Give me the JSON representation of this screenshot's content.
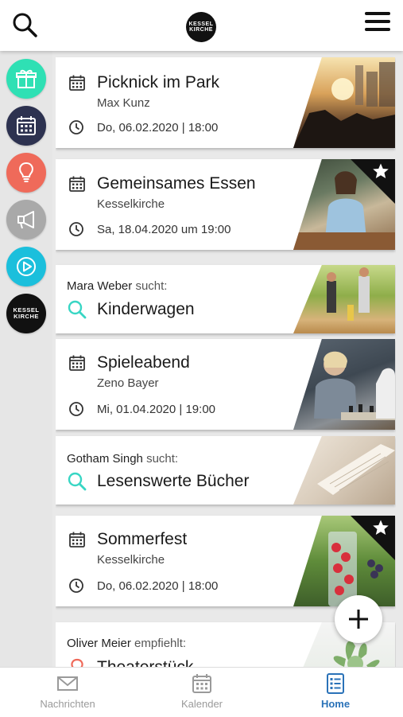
{
  "header": {
    "search_icon": "search-icon",
    "logo_line1": "KESSEL",
    "logo_line2": "KIRCHE",
    "menu_icon": "hamburger-menu-icon"
  },
  "rail": {
    "items": [
      {
        "icon": "gift-icon",
        "color": "#2fe0b4"
      },
      {
        "icon": "calendar-icon",
        "color": "#2d3250"
      },
      {
        "icon": "lightbulb-icon",
        "color": "#ef6a5a"
      },
      {
        "icon": "megaphone-icon",
        "color": "#a9a9a9"
      },
      {
        "icon": "play-icon",
        "color": "#1bbfdc"
      },
      {
        "icon": "kesselkirche-logo",
        "color": "#111111",
        "line1": "KESSEL",
        "line2": "KIRCHE"
      }
    ]
  },
  "cards": {
    "picknick": {
      "title": "Picknick im Park",
      "subtitle": "Max Kunz",
      "date": "Do, 06.02.2020 | 18:00"
    },
    "essen": {
      "title": "Gemeinsames Essen",
      "subtitle": "Kesselkirche",
      "date": "Sa, 18.04.2020 um 19:00",
      "favorite": true
    },
    "kinderwagen": {
      "person": "Mara Weber",
      "verb": "sucht:",
      "title": "Kinderwagen"
    },
    "spieleabend": {
      "title": "Spieleabend",
      "subtitle": "Zeno Bayer",
      "date": "Mi, 01.04.2020 | 19:00"
    },
    "buecher": {
      "person": "Gotham Singh",
      "verb": "sucht:",
      "title": "Lesenswerte Bücher"
    },
    "sommerfest": {
      "title": "Sommerfest",
      "subtitle": "Kesselkirche",
      "date": "Do, 06.02.2020 | 18:00",
      "favorite": true
    },
    "theater": {
      "person": "Oliver Meier",
      "verb": "empfiehlt:",
      "title": "Theaterstück"
    }
  },
  "fab": {
    "icon": "plus-icon"
  },
  "tabs": [
    {
      "label": "Nachrichten",
      "icon": "mail-icon"
    },
    {
      "label": "Kalender",
      "icon": "calendar-icon"
    },
    {
      "label": "Home",
      "icon": "home-list-icon",
      "active": true
    }
  ],
  "colors": {
    "accent": "#2a72b8",
    "search_icon": "#38d6c4"
  }
}
